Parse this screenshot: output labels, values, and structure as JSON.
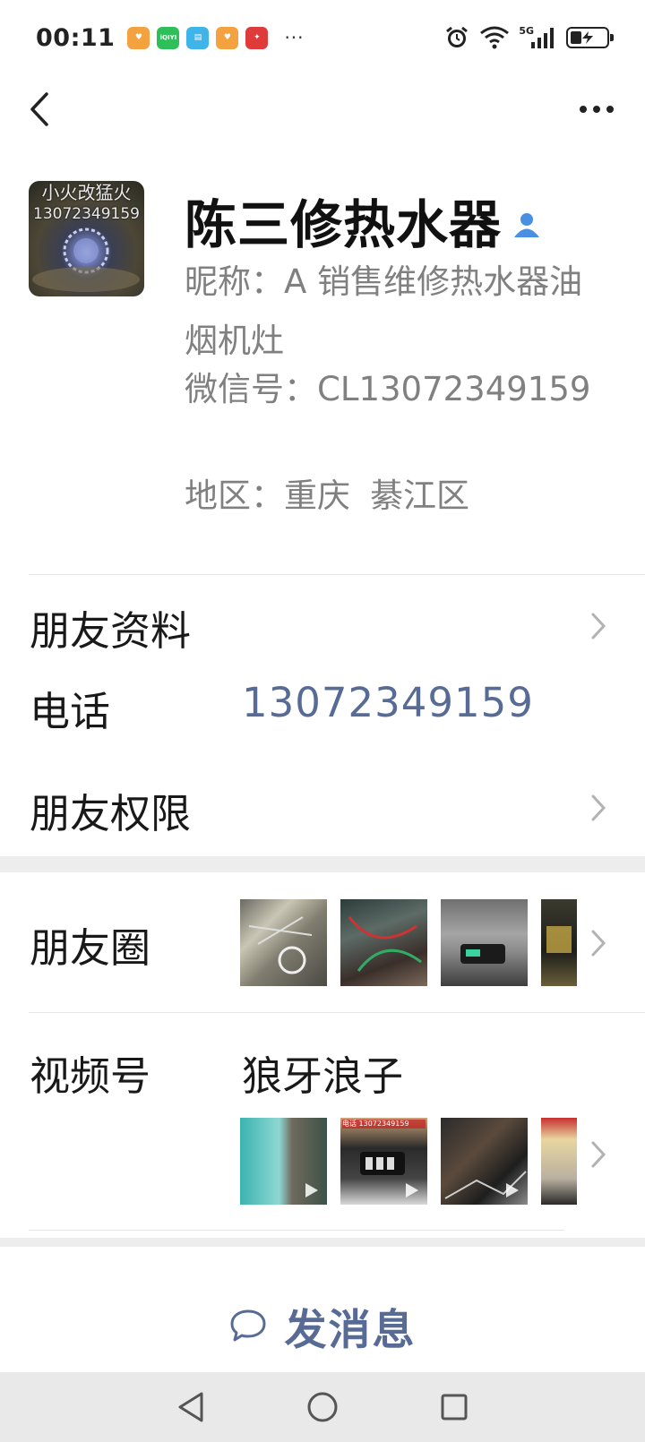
{
  "status_bar": {
    "time": "00:11",
    "more": "···",
    "network": "5G",
    "app_icons": [
      "heart-badge-app-icon",
      "iqiyi-app-icon",
      "book-app-icon",
      "heart-badge-app-icon",
      "game-app-icon"
    ],
    "iqiyi_label": "iQIYI"
  },
  "nav": {
    "back_icon": "chevron-left-icon",
    "more_icon": "more-dots-icon"
  },
  "profile": {
    "avatar_text_line1": "小火改猛火",
    "avatar_text_line2": "13072349159",
    "name": "陈三修热水器",
    "nickname": "昵称：A 销售维修热水器油烟机灶",
    "wechat_id": "微信号：CL13072349159",
    "region_label": "地区：",
    "region_city": "重庆",
    "region_district": "綦江区"
  },
  "rows": {
    "friend_info": "朋友资料",
    "phone_label": "电话",
    "phone_value": "13072349159",
    "permissions": "朋友权限",
    "moments": "朋友圈",
    "channels": "视频号",
    "channel_name": "狼牙浪子"
  },
  "moments_thumbs": [
    "water-heater-internals-photo",
    "water-heater-wiring-photo",
    "water-heater-display-photo",
    "appliance-panel-photo"
  ],
  "channel_thumbs": [
    "video-thumb-1",
    "video-thumb-2",
    "video-thumb-3",
    "video-thumb-4"
  ],
  "channel_thumb_caption": "电话 13072349159",
  "actions": {
    "send_message": "发消息"
  },
  "colors": {
    "link_blue": "#576b95",
    "contact_icon_blue": "#4a90e2",
    "separator": "#ededed"
  }
}
